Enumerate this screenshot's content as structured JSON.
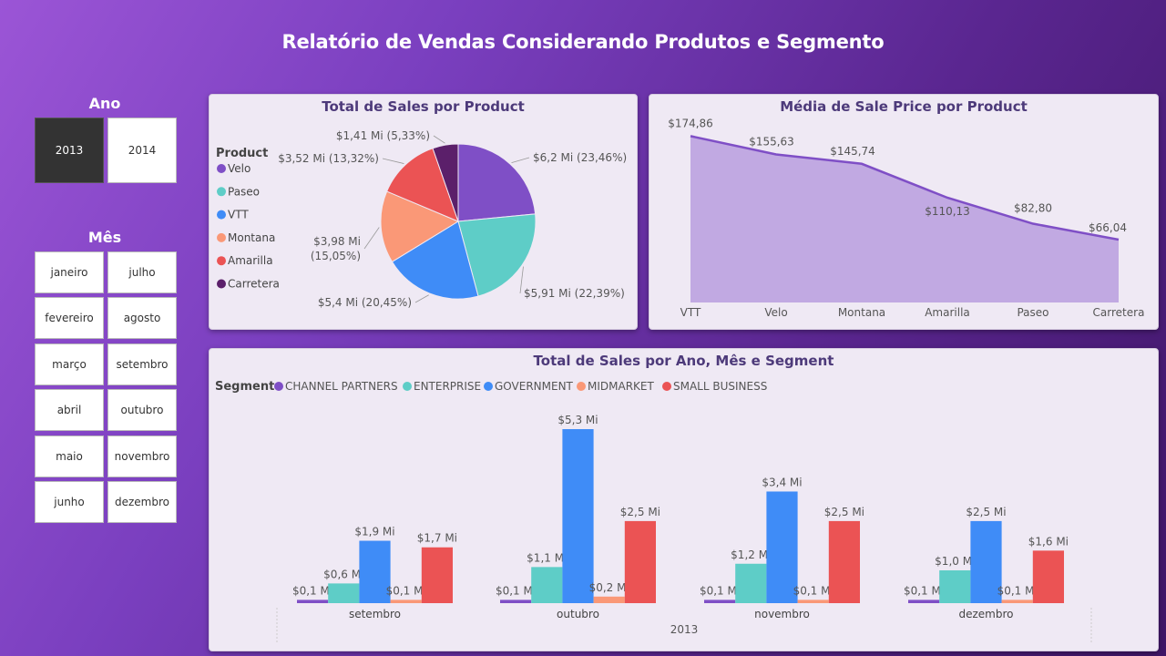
{
  "header": {
    "title": "Relatório de Vendas Considerando Produtos e Segmento"
  },
  "slicers": {
    "ano": {
      "title": "Ano",
      "options": [
        "2013",
        "2014"
      ],
      "selected": "2013"
    },
    "mes": {
      "title": "Mês",
      "options": [
        "janeiro",
        "julho",
        "fevereiro",
        "agosto",
        "março",
        "setembro",
        "abril",
        "outubro",
        "maio",
        "novembro",
        "junho",
        "dezembro"
      ]
    }
  },
  "pie": {
    "title": "Total de Sales por Product",
    "legend_title": "Product",
    "colors": {
      "Velo": "#7f4fc6",
      "Paseo": "#5ecdc7",
      "VTT": "#3f8cf7",
      "Montana": "#fa9877",
      "Amarilla": "#eb5354",
      "Carretera": "#5b1f6a"
    }
  },
  "line": {
    "title": "Média de Sale Price por Product",
    "color": "#7f4fc6",
    "fill": "#c1a9e2"
  },
  "bars": {
    "title": "Total de Sales por Ano, Mês e Segment",
    "legend_title": "Segment",
    "year_label": "2013",
    "colors": {
      "CHANNEL PARTNERS": "#7f4fc6",
      "ENTERPRISE": "#5ecdc7",
      "GOVERNMENT": "#3f8cf7",
      "MIDMARKET": "#fa9877",
      "SMALL BUSINESS": "#eb5354"
    }
  },
  "chart_data": [
    {
      "type": "pie",
      "title": "Total de Sales por Product",
      "legend_title": "Product",
      "categories": [
        "Velo",
        "Paseo",
        "VTT",
        "Montana",
        "Amarilla",
        "Carretera"
      ],
      "values": [
        6.2,
        5.91,
        5.4,
        3.98,
        3.52,
        1.41
      ],
      "labels": [
        "$6,2 Mi (23,46%)",
        "$5,91 Mi (22,39%)",
        "$5,4 Mi (20,45%)",
        "$3,98 Mi (15,05%)",
        "$3,52 Mi (13,32%)",
        "$1,41 Mi (5,33%)"
      ]
    },
    {
      "type": "area",
      "title": "Média de Sale Price por Product",
      "categories": [
        "VTT",
        "Velo",
        "Montana",
        "Amarilla",
        "Paseo",
        "Carretera"
      ],
      "values": [
        174.86,
        155.63,
        145.74,
        110.13,
        82.8,
        66.04
      ],
      "labels": [
        "$174,86",
        "$155,63",
        "$145,74",
        "$110,13",
        "$82,80",
        "$66,04"
      ]
    },
    {
      "type": "bar",
      "title": "Total de Sales por Ano, Mês e Segment",
      "legend_title": "Segment",
      "categories": [
        "setembro",
        "outubro",
        "novembro",
        "dezembro"
      ],
      "xlabel": "2013",
      "series": [
        {
          "name": "CHANNEL PARTNERS",
          "values": [
            0.1,
            0.1,
            0.1,
            0.1
          ],
          "labels": [
            "$0,1 Mi",
            "$0,1 Mi",
            "$0,1 Mi",
            "$0,1 Mi"
          ]
        },
        {
          "name": "ENTERPRISE",
          "values": [
            0.6,
            1.1,
            1.2,
            1.0
          ],
          "labels": [
            "$0,6 Mi",
            "$1,1 Mi",
            "$1,2 Mi",
            "$1,0 Mi"
          ]
        },
        {
          "name": "GOVERNMENT",
          "values": [
            1.9,
            5.3,
            3.4,
            2.5
          ],
          "labels": [
            "$1,9 Mi",
            "$5,3 Mi",
            "$3,4 Mi",
            "$2,5 Mi"
          ]
        },
        {
          "name": "MIDMARKET",
          "values": [
            0.1,
            0.2,
            0.1,
            0.1
          ],
          "labels": [
            "$0,1 Mi",
            "$0,2 Mi",
            "$0,1 Mi",
            "$0,1 Mi"
          ]
        },
        {
          "name": "SMALL BUSINESS",
          "values": [
            1.7,
            2.5,
            2.5,
            1.6
          ],
          "labels": [
            "$1,7 Mi",
            "$2,5 Mi",
            "$2,5 Mi",
            "$1,6 Mi"
          ]
        }
      ]
    }
  ]
}
